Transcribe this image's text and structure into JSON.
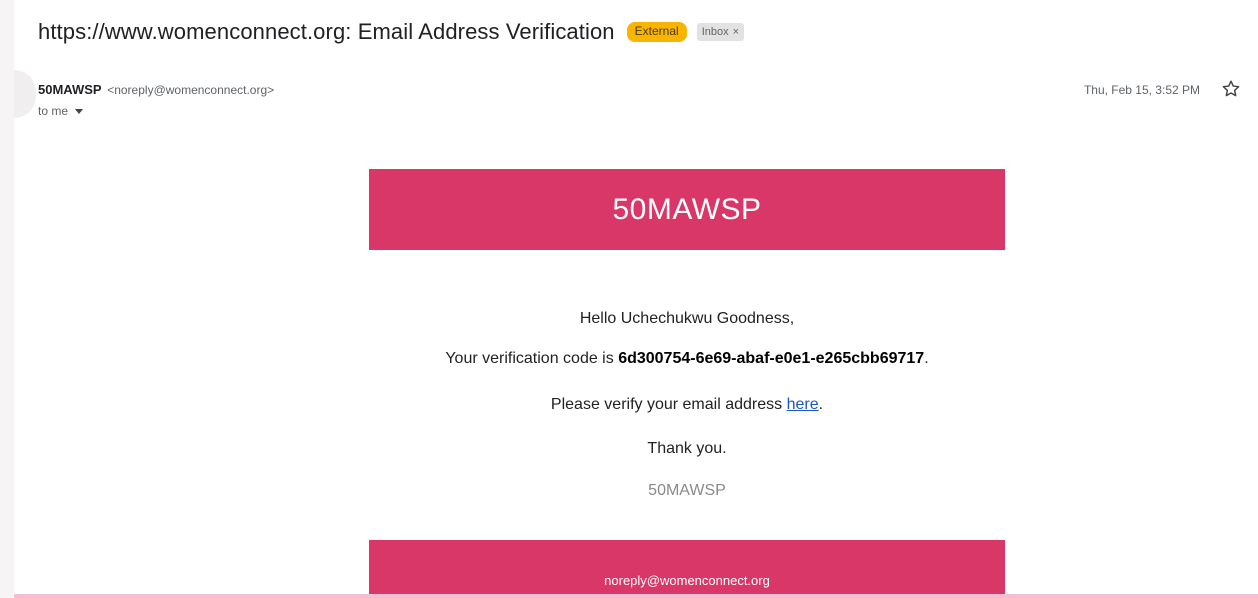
{
  "email": {
    "subject": "https://www.womenconnect.org: Email Address Verification",
    "labels": {
      "external": "External",
      "inbox": "Inbox",
      "inbox_remove": "×"
    },
    "sender": {
      "name": "50MAWSP",
      "address": "<noreply@womenconnect.org>"
    },
    "recipient_label": "to me",
    "date": "Thu, Feb 15, 3:52 PM",
    "icons": {
      "star": "star-outline-icon",
      "recipient_details": "caret-down-icon"
    }
  },
  "message": {
    "banner_title": "50MAWSP",
    "greeting": "Hello Uchechukwu Goodness,",
    "code_prefix": "Your verification code is ",
    "code": "6d300754-6e69-abaf-e0e1-e265cbb69717",
    "code_suffix": ".",
    "verify_prefix": "Please verify your email address ",
    "verify_link": "here",
    "verify_suffix": ".",
    "thanks": "Thank you.",
    "signature": "50MAWSP",
    "footer_email": "noreply@womenconnect.org"
  },
  "colors": {
    "brand_pink": "#d93768",
    "external_badge": "#f7b400",
    "link_blue": "#1a57c9"
  }
}
